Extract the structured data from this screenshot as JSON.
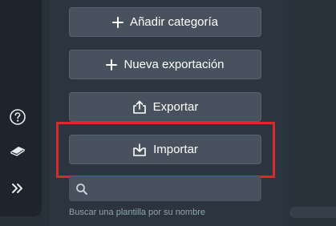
{
  "sidebar": {
    "icons": [
      {
        "name": "help-circle-icon"
      },
      {
        "name": "book-icon"
      },
      {
        "name": "double-chevron-right-icon"
      }
    ]
  },
  "actions": {
    "add_category": {
      "label": "Añadir categoría",
      "icon": "plus-icon"
    },
    "new_export": {
      "label": "Nueva exportación",
      "icon": "plus-icon"
    },
    "export": {
      "label": "Exportar",
      "icon": "upload-icon"
    },
    "import": {
      "label": "Importar",
      "icon": "download-icon"
    }
  },
  "search": {
    "placeholder": "",
    "value": "",
    "hint": "Buscar una plantilla por su nombre"
  },
  "colors": {
    "background": "#283039",
    "panel": "#2c353f",
    "button": "#47525e",
    "highlight": "#d92a2a",
    "hint_text": "#8fa2b2"
  }
}
